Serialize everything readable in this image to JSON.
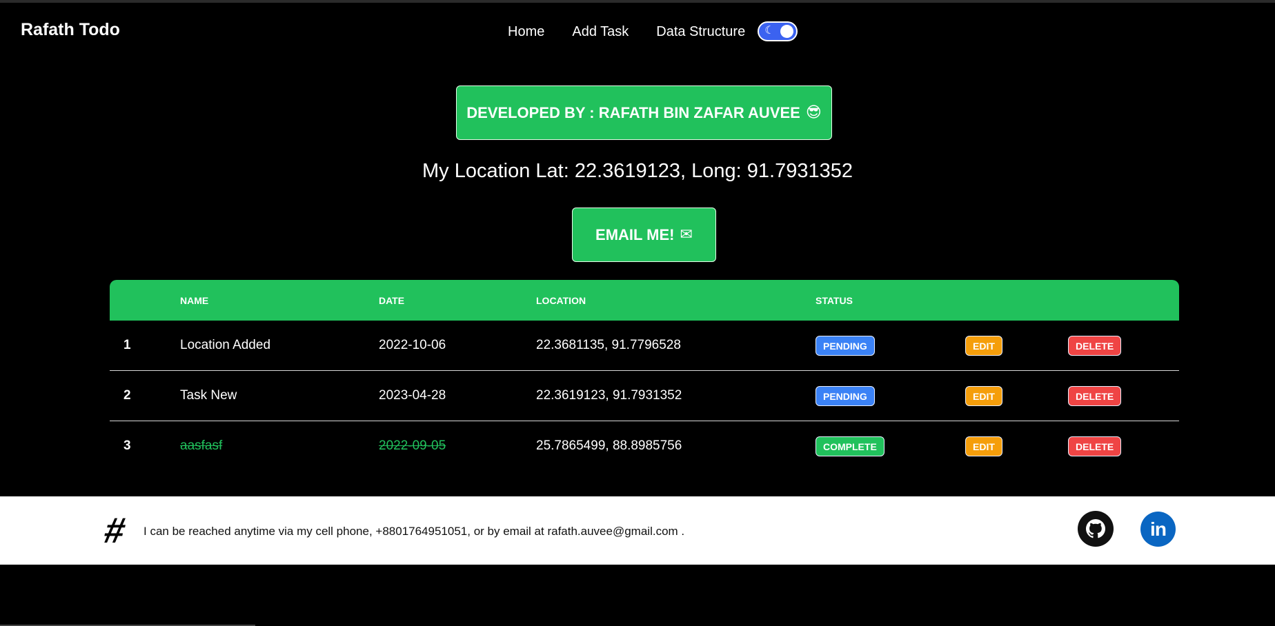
{
  "nav": {
    "brand": "Rafath Todo",
    "links": [
      "Home",
      "Add Task",
      "Data Structure"
    ],
    "toggle_icon": "moon-icon",
    "toggle_on": true
  },
  "hero": {
    "developer_label": "DEVELOPED BY : RAFATH BIN ZAFAR AUVEE",
    "developer_emoji": "😎",
    "location_text": "My Location Lat: 22.3619123, Long: 91.7931352",
    "email_label": "EMAIL ME!",
    "email_emoji": "✉"
  },
  "table": {
    "headers": [
      "",
      "NAME",
      "DATE",
      "LOCATION",
      "STATUS",
      "",
      ""
    ],
    "rows": [
      {
        "num": "1",
        "name": "Location Added",
        "date": "2022-10-06",
        "location": "22.3681135, 91.7796528",
        "status": "PENDING",
        "edit": "EDIT",
        "delete": "DELETE",
        "done": false
      },
      {
        "num": "2",
        "name": "Task New",
        "date": "2023-04-28",
        "location": "22.3619123, 91.7931352",
        "status": "PENDING",
        "edit": "EDIT",
        "delete": "DELETE",
        "done": false
      },
      {
        "num": "3",
        "name": "aasfasf",
        "date": "2022-09-05",
        "location": "25.7865499, 88.8985756",
        "status": "COMPLETE",
        "edit": "EDIT",
        "delete": "DELETE",
        "done": true
      }
    ]
  },
  "footer": {
    "text": "I can be reached anytime via my cell phone, +8801764951051, or by email at rafath.auvee@gmail.com  .",
    "icons": [
      "hash-icon",
      "github-icon",
      "linkedin-icon"
    ],
    "linkedin_glyph": "in"
  },
  "colors": {
    "accent": "#21c15c",
    "pending": "#3b82f6",
    "edit": "#f59e0b",
    "delete": "#ef4444",
    "linkedin": "#0a66c2"
  }
}
